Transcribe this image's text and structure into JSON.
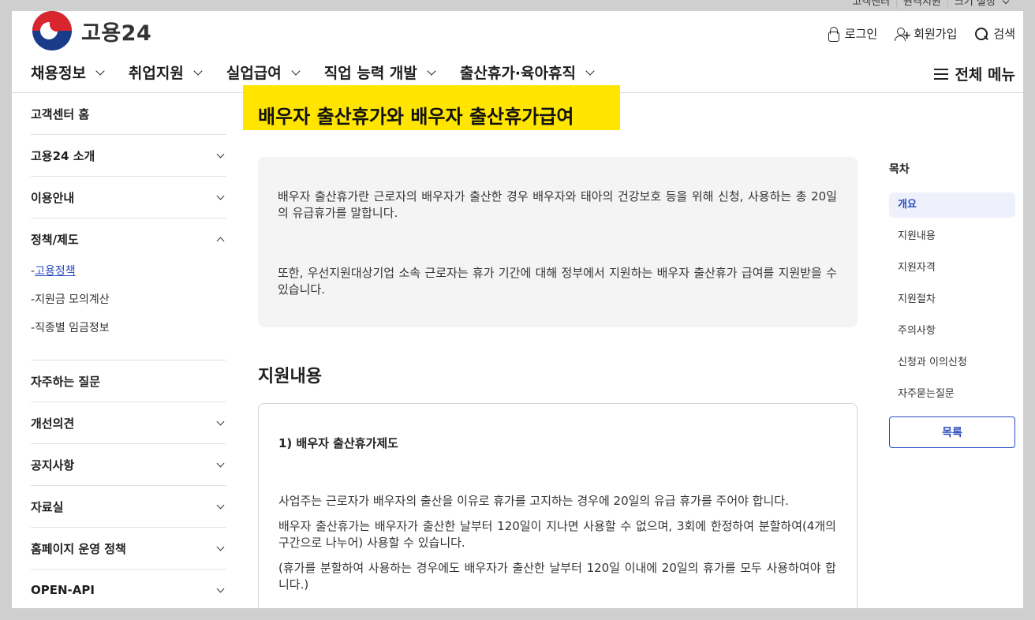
{
  "utility": {
    "items": [
      "고객센터",
      "원격지원",
      "크기 설정"
    ]
  },
  "logo": {
    "name": "고용24"
  },
  "user_tools": {
    "login": "로그인",
    "signup": "회원가입",
    "search": "검색"
  },
  "gnb": [
    "채용정보",
    "취업지원",
    "실업급여",
    "직업 능력 개발",
    "출산휴가·육아휴직"
  ],
  "all_menu": "전체 메뉴",
  "lnb": {
    "home": "고객센터 홈",
    "intro": "고용24 소개",
    "guide": "이용안내",
    "policy": "정책/제도",
    "sub": [
      "고용정책",
      "지원금 모의계산",
      "직종별 임금정보"
    ],
    "faq": "자주하는 질문",
    "opinion": "개선의견",
    "notice": "공지사항",
    "library": "자료실",
    "site_policy": "홈페이지 운영 정책",
    "api": "OPEN-API"
  },
  "page": {
    "title": "배우자 출산휴가와 배우자 출산휴가급여",
    "summary": [
      "배우자 출산휴가란 근로자의 배우자가 출산한 경우 배우자와 태아의 건강보호 등을 위해 신청, 사용하는 총 20일의 유급휴가를 말합니다.",
      "또한, 우선지원대상기업 소속 근로자는 휴가 기간에 대해 정부에서 지원하는 배우자 출산휴가 급여를 지원받을 수 있습니다."
    ],
    "section_title": "지원내용",
    "content_heading": "1) 배우자 출산휴가제도",
    "content": [
      "사업주는 근로자가 배우자의 출산을 이유로 휴가를 고지하는 경우에 20일의 유급 휴가를 주어야 합니다.",
      "배우자 출산휴가는 배우자가 출산한 날부터 120일이 지나면 사용할 수 없으며, 3회에 한정하여 분할하여(4개의 구간으로 나누어) 사용할 수 있습니다.",
      "(휴가를 분할하여 사용하는 경우에도 배우자가 출산한 날부터 120일 이내에 20일의 휴가를 모두 사용하여야 합니다.)"
    ]
  },
  "toc": {
    "heading": "목차",
    "items": [
      "개요",
      "지원내용",
      "지원자격",
      "지원절차",
      "주의사항",
      "신청과 이의신청",
      "자주묻는질문"
    ],
    "list_button": "목록"
  }
}
